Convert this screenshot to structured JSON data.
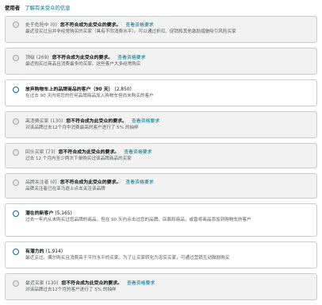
{
  "header": {
    "label": "使用者",
    "link": "了解有关受众的信息"
  },
  "audiences": [
    {
      "name": "处于危险中",
      "count": "(0)",
      "warning": "您不符合成为此受众的要求。",
      "link": "查看资格要求",
      "description": "最近没买过且并非经常购买的买家（具有不同消费水平）。可以通过折扣、促销和其他激励措施吸引风险买家",
      "enabled": false
    },
    {
      "name": "顶级",
      "count": "(269)",
      "warning": "您不符合成为此受众的要求。",
      "link": "查看资格要求",
      "description": "最近购买过商品且消费最多的买家。这些客户大多经常购买",
      "enabled": false
    },
    {
      "name": "放弃购物车上的品牌商品的客户（90 天）",
      "count": "(2,850)",
      "warning": "",
      "link": "",
      "description": "在过去 90 天内将您的任何品牌商品加入购物车但尚未购买的客户",
      "enabled": true
    },
    {
      "name": "高消费买家",
      "count": "(130)",
      "warning": "您不符合成为此受众的要求。",
      "link": "查看资格要求",
      "description": "对该品牌过去12个月中消费最高的客户进行了 5% 的抽样",
      "enabled": false
    },
    {
      "name": "回头买家",
      "count": "(73)",
      "warning": "您不符合成为此受众的要求。",
      "link": "查看资格要求",
      "description": "过去 12 个月内至少两次下单购买过该品牌商品的买家",
      "enabled": false
    },
    {
      "name": "品牌关注者",
      "count": "(0)",
      "warning": "您不符合成为此受众的要求。",
      "link": "查看资格要求",
      "description": "品牌关注者已在亚马逊上点击关注该品牌",
      "enabled": false
    },
    {
      "name": "潜在的新客户",
      "count": "(5,165)",
      "warning": "",
      "link": "",
      "description": "过去一年内从未购买过您品牌的商品，但在 90 天内点击过您的品牌、店面和商品，或曾将商品添加到购物车的客户",
      "enabled": true
    },
    {
      "name": "有潜力的",
      "count": "(1,914)",
      "warning": "",
      "link": "",
      "description": "最近买过、偶尔购买且消费高于平均水平的买家。为了让买家转化为忠实买家，可通过营销互动鼓励购买",
      "enabled": true
    },
    {
      "name": "最近买家",
      "count": "(130)",
      "warning": "您不符合成为此受众的要求。",
      "link": "查看资格要求",
      "description": "对该品牌过去12个月的客户进行了 5% 的抽样",
      "enabled": false
    }
  ]
}
